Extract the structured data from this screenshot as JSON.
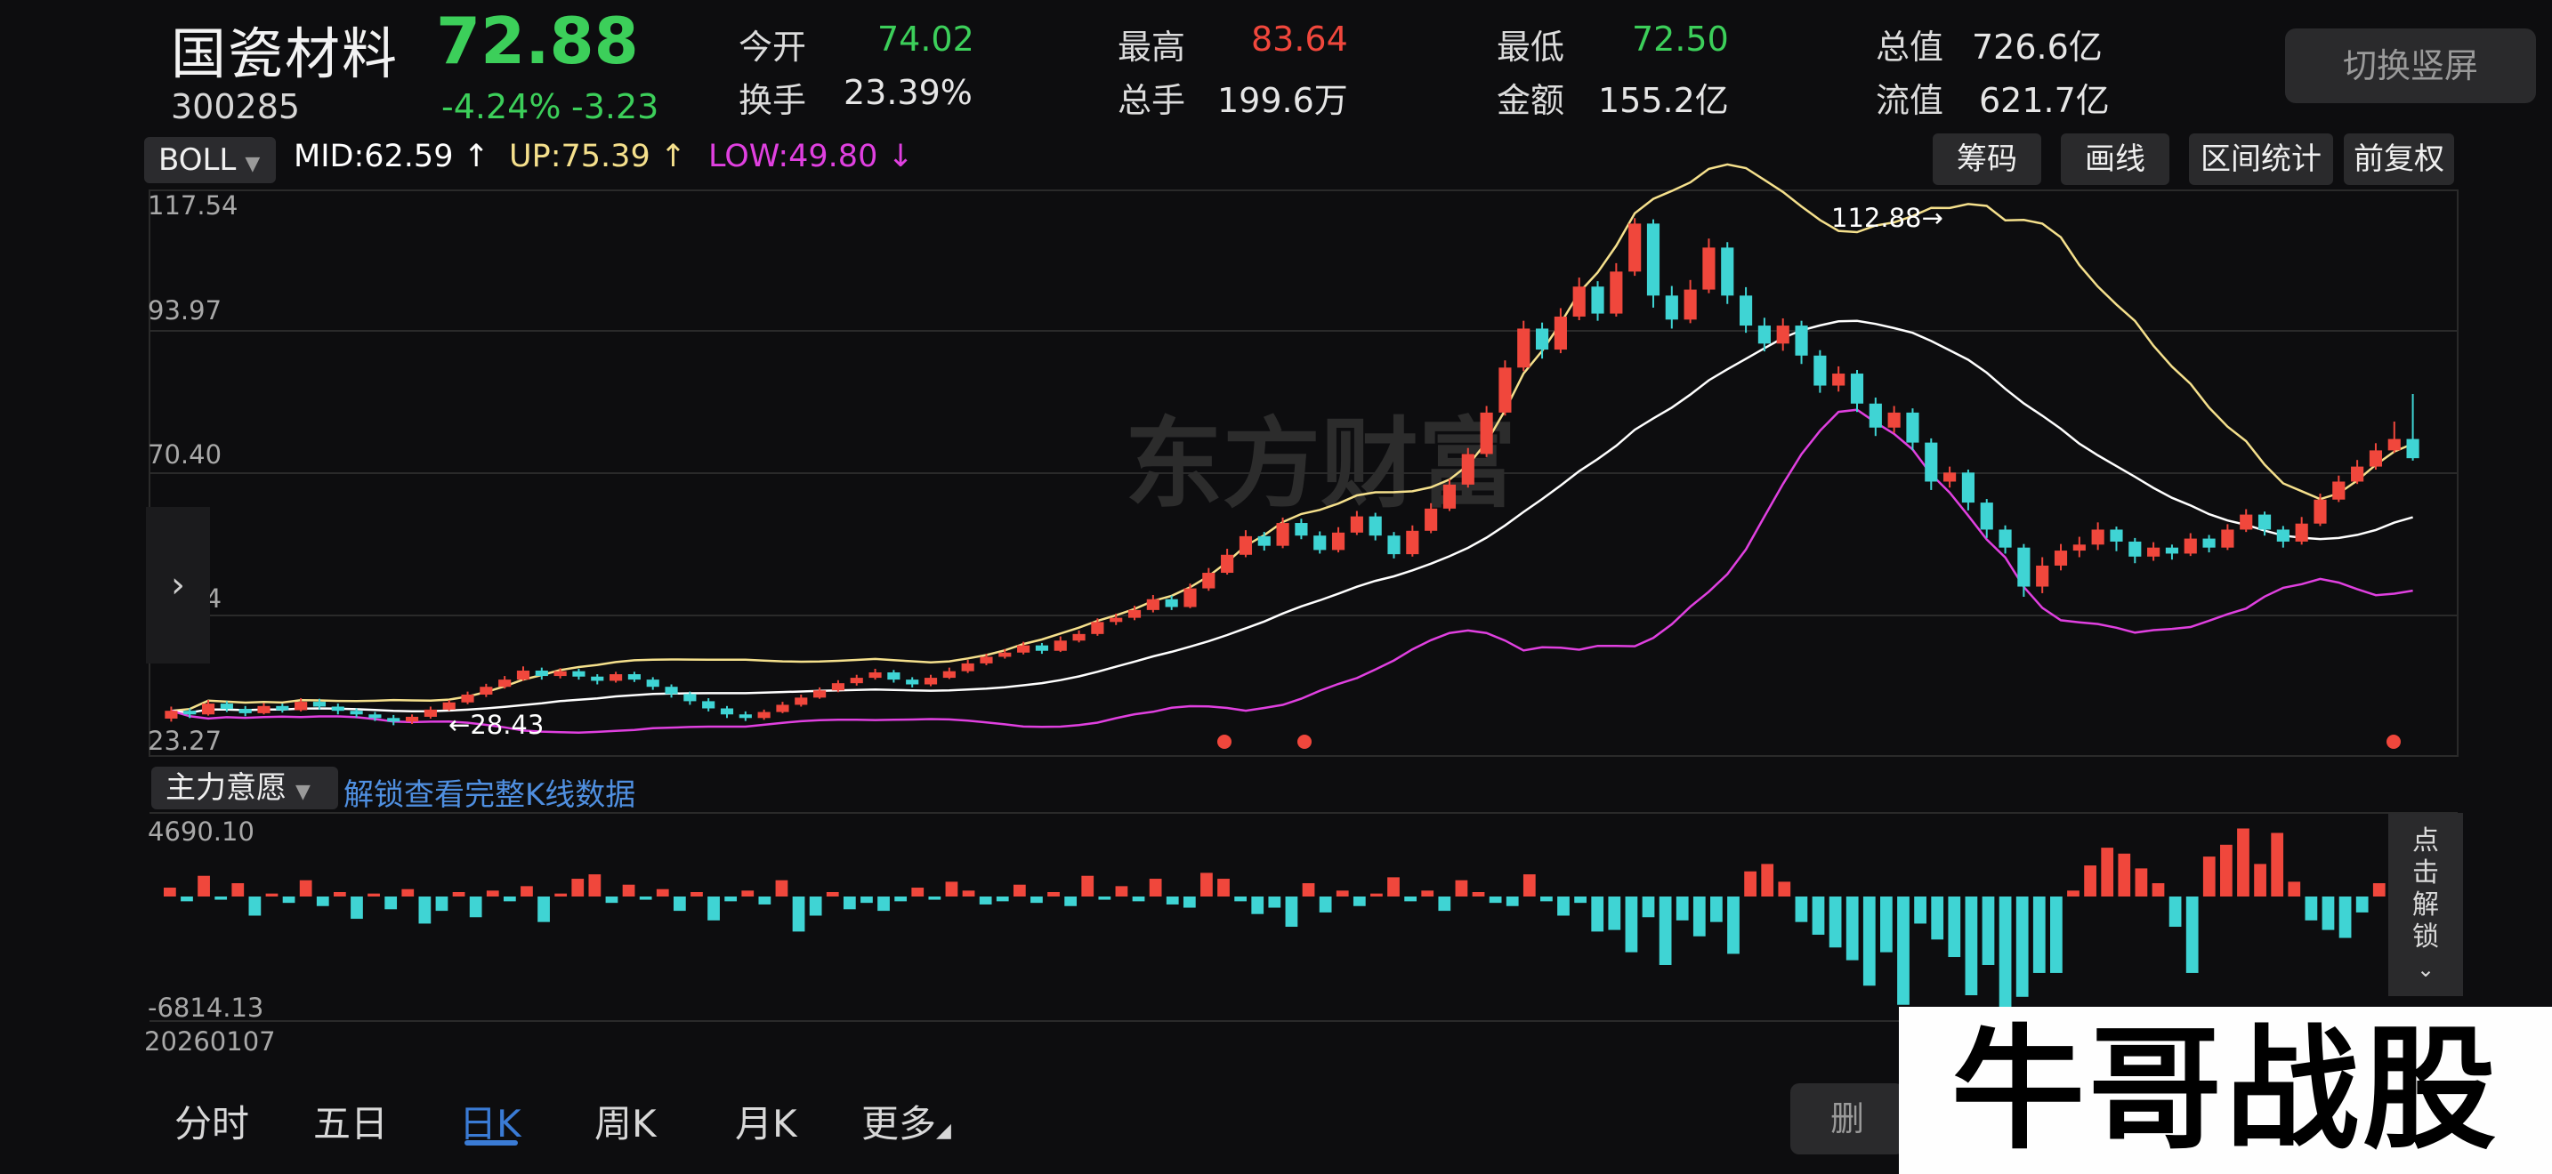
{
  "stock": {
    "name": "国瓷材料",
    "code": "300285",
    "price": "72.88",
    "pct": "-4.24%",
    "change": "-3.23"
  },
  "stats": [
    {
      "label": "今开",
      "value": "74.02",
      "color": "#3ccf5a"
    },
    {
      "label": "最高",
      "value": "83.64",
      "color": "#f0473c"
    },
    {
      "label": "最低",
      "value": "72.50",
      "color": "#3ccf5a"
    },
    {
      "label": "总值",
      "value": "726.6亿",
      "color": "#e6e6e6"
    },
    {
      "label": "换手",
      "value": "23.39%",
      "color": "#e6e6e6"
    },
    {
      "label": "总手",
      "value": "199.6万",
      "color": "#e6e6e6"
    },
    {
      "label": "金额",
      "value": "155.2亿",
      "color": "#e6e6e6"
    },
    {
      "label": "流值",
      "value": "621.7亿",
      "color": "#e6e6e6"
    }
  ],
  "switch_label": "切换竖屏",
  "indicator": {
    "selected": "BOLL",
    "mid": "MID:62.59",
    "up": "UP:75.39",
    "low": "LOW:49.80",
    "colors": {
      "mid": "#ffffff",
      "up": "#f5e08c",
      "low": "#e040e0"
    }
  },
  "tools": [
    "筹码",
    "画线",
    "区间统计",
    "前复权"
  ],
  "price_axis": [
    "117.54",
    "93.97",
    "70.40",
    "46.84",
    "23.27"
  ],
  "annotations": {
    "high": "112.88",
    "low": "28.43"
  },
  "watermark": "东方财富",
  "sub_indicator": {
    "selected": "主力意愿",
    "unlock_text": "解锁查看完整K线数据",
    "max": "4690.10",
    "min": "-6814.13"
  },
  "start_date": "20260107",
  "unlock_side": "点击解锁",
  "tabs": [
    "分时",
    "五日",
    "日K",
    "周K",
    "月K",
    "更多"
  ],
  "delete_label": "删",
  "brand": "牛哥战股",
  "colors": {
    "up": "#f0473c",
    "down": "#3fd4d4",
    "bg": "#0d0d0f"
  },
  "chart_data": {
    "type": "candlestick",
    "ylim": [
      23.27,
      117.54
    ],
    "candles": [
      [
        29.5,
        30.8,
        31.5,
        29.0
      ],
      [
        30.8,
        30.2,
        31.2,
        29.6
      ],
      [
        30.2,
        32.0,
        32.6,
        30.0
      ],
      [
        32.0,
        31.1,
        32.4,
        30.6
      ],
      [
        31.1,
        30.4,
        31.6,
        29.9
      ],
      [
        30.4,
        31.6,
        32.1,
        30.2
      ],
      [
        31.6,
        30.9,
        32.0,
        30.5
      ],
      [
        30.9,
        32.3,
        32.9,
        30.7
      ],
      [
        32.3,
        31.5,
        32.8,
        31.0
      ],
      [
        31.5,
        30.8,
        32.0,
        30.2
      ],
      [
        30.8,
        30.2,
        31.2,
        29.7
      ],
      [
        30.2,
        29.6,
        30.6,
        29.1
      ],
      [
        29.6,
        29.0,
        30.1,
        28.4
      ],
      [
        29.0,
        29.8,
        30.2,
        28.6
      ],
      [
        29.8,
        31.0,
        31.5,
        29.5
      ],
      [
        31.0,
        32.2,
        32.6,
        30.8
      ],
      [
        32.2,
        33.5,
        34.0,
        31.9
      ],
      [
        33.5,
        34.8,
        35.3,
        33.1
      ],
      [
        34.8,
        36.0,
        36.6,
        34.5
      ],
      [
        36.0,
        37.5,
        38.2,
        35.8
      ],
      [
        37.5,
        36.6,
        38.0,
        36.0
      ],
      [
        36.6,
        37.4,
        37.9,
        36.2
      ],
      [
        37.4,
        36.5,
        37.8,
        36.0
      ],
      [
        36.5,
        35.8,
        36.9,
        35.2
      ],
      [
        35.8,
        36.9,
        37.3,
        35.5
      ],
      [
        36.9,
        36.0,
        37.3,
        35.6
      ],
      [
        36.0,
        34.8,
        36.4,
        34.3
      ],
      [
        34.8,
        33.6,
        35.2,
        33.0
      ],
      [
        33.6,
        32.4,
        34.0,
        31.8
      ],
      [
        32.4,
        31.2,
        32.9,
        30.7
      ],
      [
        31.2,
        30.2,
        31.6,
        29.6
      ],
      [
        30.2,
        29.6,
        30.7,
        29.1
      ],
      [
        29.6,
        30.6,
        31.0,
        29.3
      ],
      [
        30.6,
        31.8,
        32.3,
        30.4
      ],
      [
        31.8,
        33.0,
        33.5,
        31.5
      ],
      [
        33.0,
        34.2,
        34.7,
        32.8
      ],
      [
        34.2,
        35.4,
        35.9,
        33.9
      ],
      [
        35.4,
        36.3,
        36.8,
        35.0
      ],
      [
        36.3,
        37.2,
        37.8,
        36.0
      ],
      [
        37.2,
        36.0,
        37.6,
        35.5
      ],
      [
        36.0,
        35.2,
        36.4,
        34.7
      ],
      [
        35.2,
        36.3,
        36.8,
        34.9
      ],
      [
        36.3,
        37.4,
        38.0,
        36.1
      ],
      [
        37.4,
        38.7,
        39.3,
        37.1
      ],
      [
        38.7,
        39.8,
        40.3,
        38.4
      ],
      [
        39.8,
        40.5,
        41.1,
        39.5
      ],
      [
        40.5,
        41.7,
        42.3,
        40.2
      ],
      [
        41.7,
        40.8,
        42.1,
        40.3
      ],
      [
        40.8,
        42.5,
        43.2,
        40.6
      ],
      [
        42.5,
        43.6,
        44.2,
        42.2
      ],
      [
        43.6,
        45.6,
        46.2,
        43.3
      ],
      [
        45.6,
        46.3,
        47.0,
        45.1
      ],
      [
        46.3,
        47.6,
        48.3,
        45.9
      ],
      [
        47.6,
        49.4,
        50.1,
        47.2
      ],
      [
        49.4,
        48.1,
        50.0,
        47.6
      ],
      [
        48.1,
        51.2,
        52.0,
        47.9
      ],
      [
        51.2,
        53.8,
        54.6,
        50.8
      ],
      [
        53.8,
        56.8,
        57.8,
        53.5
      ],
      [
        56.8,
        59.9,
        60.9,
        56.4
      ],
      [
        59.9,
        58.3,
        60.6,
        57.5
      ],
      [
        58.3,
        62.1,
        63.0,
        57.9
      ],
      [
        62.1,
        60.0,
        62.8,
        59.4
      ],
      [
        60.0,
        57.6,
        60.7,
        57.0
      ],
      [
        57.6,
        60.5,
        61.4,
        57.2
      ],
      [
        60.5,
        63.2,
        64.1,
        60.1
      ],
      [
        63.2,
        60.0,
        63.8,
        59.2
      ],
      [
        60.0,
        56.9,
        60.6,
        56.2
      ],
      [
        56.9,
        60.8,
        61.7,
        56.5
      ],
      [
        60.8,
        64.5,
        65.4,
        60.4
      ],
      [
        64.5,
        68.5,
        69.4,
        64.1
      ],
      [
        68.5,
        73.6,
        74.6,
        68.0
      ],
      [
        73.6,
        80.5,
        81.6,
        73.1
      ],
      [
        80.5,
        88.0,
        89.2,
        80.0
      ],
      [
        88.0,
        94.5,
        95.8,
        87.4
      ],
      [
        94.5,
        91.0,
        95.5,
        89.5
      ],
      [
        91.0,
        96.5,
        97.9,
        90.4
      ],
      [
        96.5,
        101.5,
        103.0,
        95.9
      ],
      [
        101.5,
        97.0,
        102.4,
        95.8
      ],
      [
        97.0,
        104.0,
        105.4,
        96.5
      ],
      [
        104.0,
        112.0,
        112.9,
        103.3
      ],
      [
        112.0,
        100.0,
        112.7,
        98.0
      ],
      [
        100.0,
        96.0,
        101.6,
        94.5
      ],
      [
        96.0,
        101.0,
        102.6,
        95.4
      ],
      [
        101.0,
        108.0,
        109.5,
        100.4
      ],
      [
        108.0,
        100.0,
        108.9,
        98.6
      ],
      [
        100.0,
        95.0,
        101.4,
        93.8
      ],
      [
        95.0,
        92.0,
        96.3,
        90.7
      ],
      [
        92.0,
        95.0,
        96.2,
        90.8
      ],
      [
        95.0,
        90.0,
        95.8,
        88.6
      ],
      [
        90.0,
        85.0,
        90.9,
        83.8
      ],
      [
        85.0,
        87.0,
        88.2,
        84.0
      ],
      [
        87.0,
        82.0,
        87.6,
        80.6
      ],
      [
        82.0,
        78.0,
        83.0,
        76.6
      ],
      [
        78.0,
        80.5,
        81.6,
        77.1
      ],
      [
        80.5,
        75.5,
        81.2,
        74.2
      ],
      [
        75.5,
        69.0,
        76.2,
        67.6
      ],
      [
        69.0,
        70.5,
        71.5,
        68.0
      ],
      [
        70.5,
        65.5,
        71.0,
        64.2
      ],
      [
        65.5,
        61.0,
        66.1,
        59.6
      ],
      [
        61.0,
        58.0,
        61.7,
        57.0
      ],
      [
        58.0,
        51.5,
        58.6,
        49.8
      ],
      [
        51.5,
        55.0,
        56.4,
        50.4
      ],
      [
        55.0,
        57.5,
        58.6,
        54.2
      ],
      [
        57.5,
        58.5,
        59.8,
        56.4
      ],
      [
        58.5,
        61.0,
        62.2,
        57.6
      ],
      [
        61.0,
        59.0,
        61.5,
        57.4
      ],
      [
        59.0,
        56.5,
        59.6,
        55.4
      ],
      [
        56.5,
        58.0,
        58.9,
        55.8
      ],
      [
        58.0,
        57.0,
        58.5,
        56.0
      ],
      [
        57.0,
        59.5,
        60.4,
        56.6
      ],
      [
        59.5,
        58.0,
        60.1,
        57.2
      ],
      [
        58.0,
        61.0,
        61.9,
        57.6
      ],
      [
        61.0,
        63.5,
        64.4,
        60.6
      ],
      [
        63.5,
        61.0,
        64.0,
        60.0
      ],
      [
        61.0,
        59.0,
        61.6,
        58.0
      ],
      [
        59.0,
        62.0,
        63.1,
        58.5
      ],
      [
        62.0,
        66.0,
        67.0,
        61.6
      ],
      [
        66.0,
        69.0,
        70.0,
        65.6
      ],
      [
        69.0,
        71.5,
        72.6,
        68.6
      ],
      [
        71.5,
        74.2,
        75.4,
        71.0
      ],
      [
        74.2,
        76.1,
        79.0,
        73.8
      ],
      [
        76.1,
        72.9,
        83.6,
        72.5
      ]
    ],
    "sub_values": [
      600,
      -300,
      1400,
      -200,
      900,
      -1200,
      200,
      -400,
      1100,
      -600,
      300,
      -1400,
      200,
      -800,
      500,
      -1700,
      -900,
      300,
      -1300,
      400,
      -300,
      700,
      -1600,
      200,
      1200,
      1500,
      -400,
      800,
      -200,
      500,
      -900,
      300,
      -1500,
      -300,
      400,
      -500,
      1100,
      -2200,
      -1200,
      300,
      -800,
      -400,
      -900,
      -300,
      600,
      -200,
      1000,
      400,
      -500,
      -300,
      800,
      -400,
      300,
      -600,
      1400,
      -200,
      700,
      -300,
      1200,
      -500,
      -700,
      1600,
      1200,
      -300,
      -1100,
      -700,
      -1900,
      900,
      -1000,
      400,
      -600,
      200,
      1300,
      -300,
      400,
      -900,
      1100,
      300,
      -400,
      -600,
      1500,
      -300,
      -1200,
      -400,
      -2200,
      -2100,
      -3500,
      -1300,
      -4300,
      -1500,
      -2500,
      -1600,
      -3600,
      1700,
      2200,
      1000,
      -1600,
      -2400,
      -3200,
      -4000,
      -5600,
      -3500,
      -6800,
      -1700,
      -2700,
      -3800,
      -6200,
      -4300,
      -7100,
      -6300,
      -4800,
      -4800,
      400,
      2100,
      3300,
      2900,
      1900,
      900,
      -1900,
      -4800,
      2700,
      3500,
      4600,
      2200,
      4300,
      1000,
      -1500,
      -2100,
      -2600,
      -1000,
      900
    ]
  }
}
